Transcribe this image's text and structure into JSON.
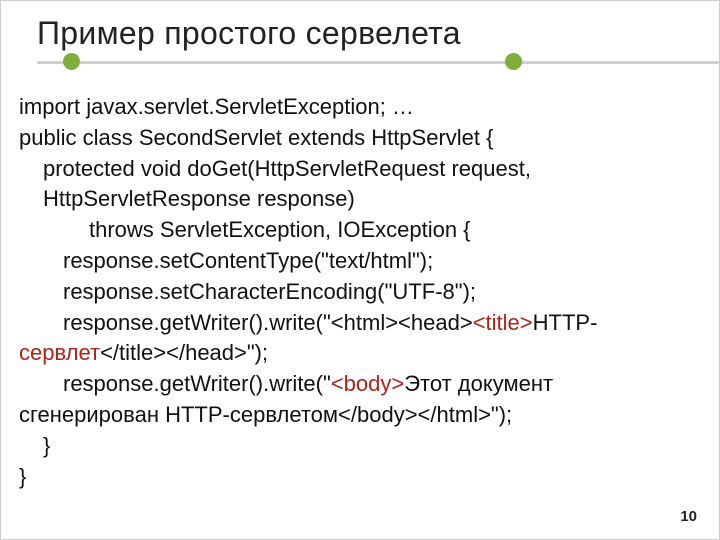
{
  "title": "Пример простого сервелета",
  "code": {
    "l1": "import javax.servlet.ServletException; …",
    "l2": "public class SecondServlet extends HttpServlet {",
    "l3": "protected void doGet(HttpServletRequest request, HttpServletResponse response)",
    "l4": "throws ServletException, IOException {",
    "l5": "response.setContentType(\"text/html\");",
    "l6": "response.setCharacterEncoding(\"UTF-8\");",
    "l7a": "response.getWriter().write(\"<html><head>",
    "kw_title": "<title>",
    "l7b": "HTTP-сервлет",
    "l7c": "</title></head>\");",
    "l8a": "response.getWriter().write(\"",
    "kw_body": "<body>",
    "l8b": "Этот документ сгенерирован HTTP-сервлетом</body></html>\");",
    "l9": "}",
    "l10": "}"
  },
  "page_number": "10"
}
